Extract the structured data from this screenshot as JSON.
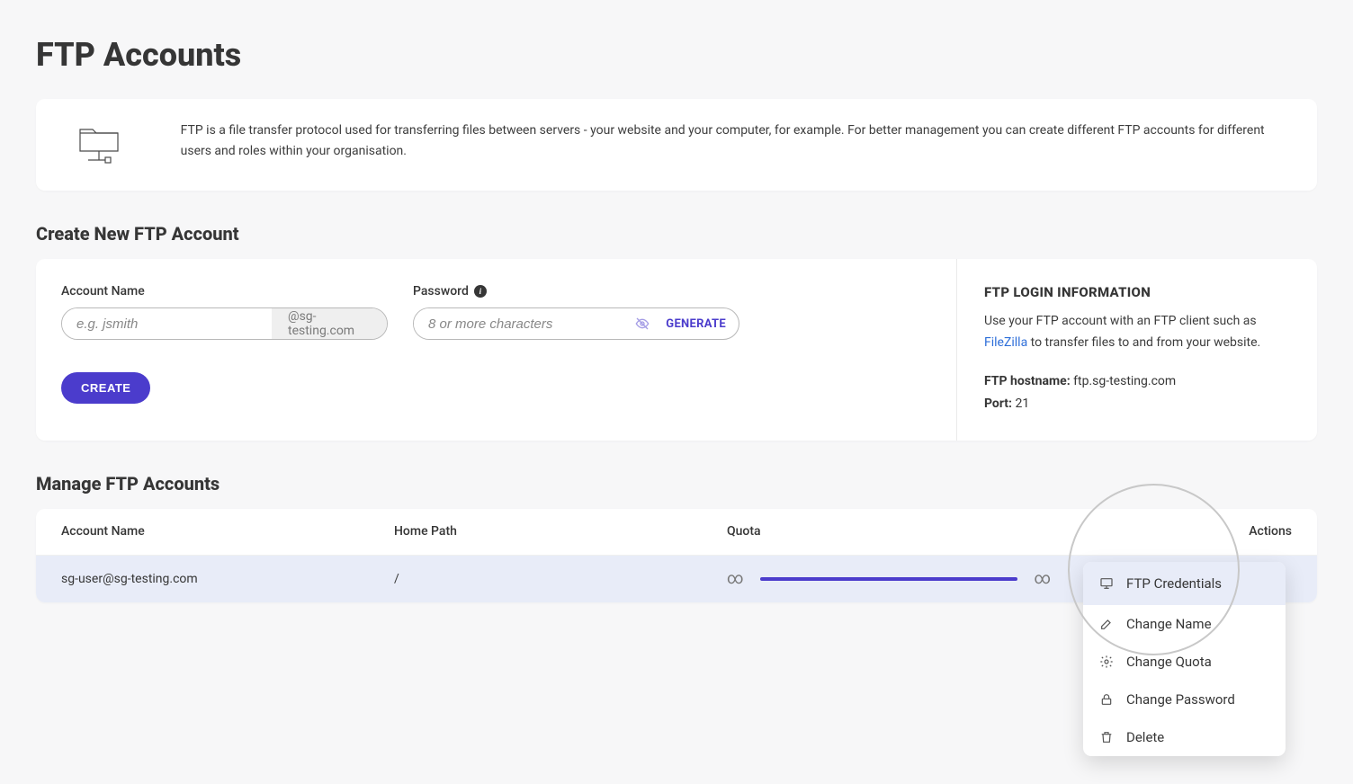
{
  "page_title": "FTP Accounts",
  "intro": {
    "text": "FTP is a file transfer protocol used for transferring files between servers - your website and your computer, for example. For better management you can create different FTP accounts for different users and roles within your organisation."
  },
  "create_section": {
    "title": "Create New FTP Account",
    "account_name_label": "Account Name",
    "account_name_placeholder": "e.g. jsmith",
    "domain_suffix": "@sg-testing.com",
    "password_label": "Password",
    "password_placeholder": "8 or more characters",
    "generate_label": "GENERATE",
    "create_button": "CREATE"
  },
  "login_info": {
    "title": "FTP LOGIN INFORMATION",
    "text_prefix": "Use your FTP account with an FTP client such as ",
    "link_label": "FileZilla",
    "text_suffix": " to transfer files to and from your website.",
    "hostname_label": "FTP hostname:",
    "hostname_value": "ftp.sg-testing.com",
    "port_label": "Port:",
    "port_value": "21"
  },
  "manage_section": {
    "title": "Manage FTP Accounts",
    "columns": {
      "account_name": "Account Name",
      "home_path": "Home Path",
      "quota": "Quota",
      "actions": "Actions"
    },
    "rows": [
      {
        "account_name": "sg-user@sg-testing.com",
        "home_path": "/",
        "quota_left": "∞",
        "quota_right": "∞"
      }
    ]
  },
  "dropdown": {
    "items": [
      {
        "label": "FTP Credentials",
        "icon": "monitor"
      },
      {
        "label": "Change Name",
        "icon": "edit"
      },
      {
        "label": "Change Quota",
        "icon": "gear"
      },
      {
        "label": "Change Password",
        "icon": "lock"
      },
      {
        "label": "Delete",
        "icon": "trash"
      }
    ]
  }
}
